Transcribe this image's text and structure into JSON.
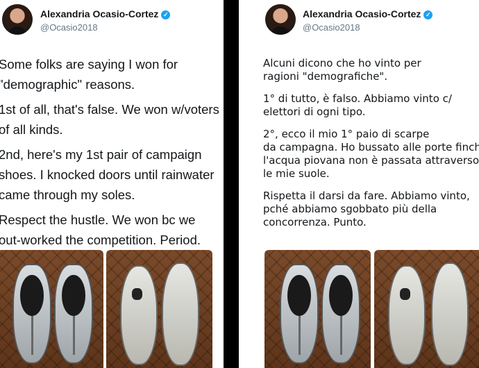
{
  "left": {
    "author": {
      "name": "Alexandria Ocasio-Cortez",
      "handle": "@Ocasio2018",
      "verified_icon": "verified-badge-icon"
    },
    "lines": [
      "Some folks are saying I won for",
      "\"demographic\" reasons.",
      "1st of all, that's false. We won w/voters",
      "of all kinds.",
      "2nd, here's my 1st pair of campaign",
      "shoes. I knocked doors until rainwater",
      "came through my soles.",
      "Respect the hustle. We won bc we",
      "out-worked the competition. Period."
    ]
  },
  "right": {
    "author": {
      "name": "Alexandria Ocasio-Cortez",
      "handle": "@Ocasio2018",
      "verified_icon": "verified-badge-icon"
    },
    "lines": [
      "Alcuni dicono che ho vinto per",
      "ragioni \"demografiche\".",
      "1° di tutto, è falso. Abbiamo vinto c/",
      "elettori di ogni tipo.",
      "2°, ecco il mio 1°  paio di scarpe",
      "da campagna. Ho bussato alle porte finché",
      "l'acqua piovana non è passata attraverso",
      "le mie suole.",
      "Rispetta il darsi da fare. Abbiamo vinto,",
      "pché abbiamo sgobbato più della",
      "concorrenza. Punto."
    ]
  }
}
